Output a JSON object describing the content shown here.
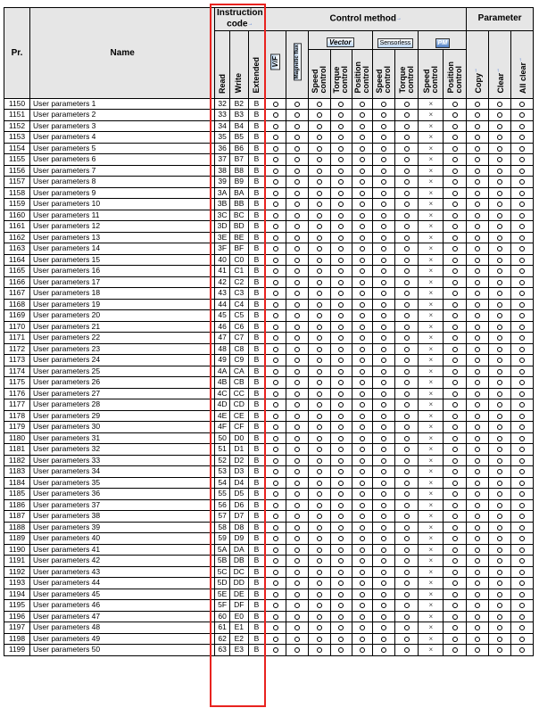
{
  "header": {
    "pr": "Pr.",
    "name": "Name",
    "instruction_code": "Instruction\ncode",
    "control_method": "Control method",
    "parameter": "Parameter",
    "read": "Read",
    "write": "Write",
    "extended": "Extended",
    "vf_badge": "V/F",
    "magnetic_flux_badge": "Magnetic flux",
    "vector_badge": "Vector",
    "sensorless_badge": "Sensorless",
    "pm_badge": "PM",
    "speed_control": "Speed\ncontrol",
    "torque_control": "Torque\ncontrol",
    "position_control": "Position\ncontrol",
    "copy": "Copy",
    "clear": "Clear",
    "all_clear": "All clear"
  },
  "mark_symbol": "→",
  "accent_color": "#e8231f",
  "header_bg_color": "#e6e6e6",
  "column_marks": [
    "o",
    "o",
    "o",
    "o",
    "o",
    "o",
    "o",
    "x",
    "o",
    "o",
    "o",
    "o"
  ],
  "rows": [
    {
      "pr": "1150",
      "name": "User parameters 1",
      "read": "32",
      "write": "B2",
      "ext": "B"
    },
    {
      "pr": "1151",
      "name": "User parameters 2",
      "read": "33",
      "write": "B3",
      "ext": "B"
    },
    {
      "pr": "1152",
      "name": "User parameters 3",
      "read": "34",
      "write": "B4",
      "ext": "B"
    },
    {
      "pr": "1153",
      "name": "User parameters 4",
      "read": "35",
      "write": "B5",
      "ext": "B"
    },
    {
      "pr": "1154",
      "name": "User parameters 5",
      "read": "36",
      "write": "B6",
      "ext": "B"
    },
    {
      "pr": "1155",
      "name": "User parameters 6",
      "read": "37",
      "write": "B7",
      "ext": "B"
    },
    {
      "pr": "1156",
      "name": "User parameters 7",
      "read": "38",
      "write": "B8",
      "ext": "B"
    },
    {
      "pr": "1157",
      "name": "User parameters 8",
      "read": "39",
      "write": "B9",
      "ext": "B"
    },
    {
      "pr": "1158",
      "name": "User parameters 9",
      "read": "3A",
      "write": "BA",
      "ext": "B"
    },
    {
      "pr": "1159",
      "name": "User parameters 10",
      "read": "3B",
      "write": "BB",
      "ext": "B"
    },
    {
      "pr": "1160",
      "name": "User parameters 11",
      "read": "3C",
      "write": "BC",
      "ext": "B"
    },
    {
      "pr": "1161",
      "name": "User parameters 12",
      "read": "3D",
      "write": "BD",
      "ext": "B"
    },
    {
      "pr": "1162",
      "name": "User parameters 13",
      "read": "3E",
      "write": "BE",
      "ext": "B"
    },
    {
      "pr": "1163",
      "name": "User parameters 14",
      "read": "3F",
      "write": "BF",
      "ext": "B"
    },
    {
      "pr": "1164",
      "name": "User parameters 15",
      "read": "40",
      "write": "C0",
      "ext": "B"
    },
    {
      "pr": "1165",
      "name": "User parameters 16",
      "read": "41",
      "write": "C1",
      "ext": "B"
    },
    {
      "pr": "1166",
      "name": "User parameters 17",
      "read": "42",
      "write": "C2",
      "ext": "B"
    },
    {
      "pr": "1167",
      "name": "User parameters 18",
      "read": "43",
      "write": "C3",
      "ext": "B"
    },
    {
      "pr": "1168",
      "name": "User parameters 19",
      "read": "44",
      "write": "C4",
      "ext": "B"
    },
    {
      "pr": "1169",
      "name": "User parameters 20",
      "read": "45",
      "write": "C5",
      "ext": "B"
    },
    {
      "pr": "1170",
      "name": "User parameters 21",
      "read": "46",
      "write": "C6",
      "ext": "B"
    },
    {
      "pr": "1171",
      "name": "User parameters 22",
      "read": "47",
      "write": "C7",
      "ext": "B"
    },
    {
      "pr": "1172",
      "name": "User parameters 23",
      "read": "48",
      "write": "C8",
      "ext": "B"
    },
    {
      "pr": "1173",
      "name": "User parameters 24",
      "read": "49",
      "write": "C9",
      "ext": "B"
    },
    {
      "pr": "1174",
      "name": "User parameters 25",
      "read": "4A",
      "write": "CA",
      "ext": "B"
    },
    {
      "pr": "1175",
      "name": "User parameters 26",
      "read": "4B",
      "write": "CB",
      "ext": "B"
    },
    {
      "pr": "1176",
      "name": "User parameters 27",
      "read": "4C",
      "write": "CC",
      "ext": "B"
    },
    {
      "pr": "1177",
      "name": "User parameters 28",
      "read": "4D",
      "write": "CD",
      "ext": "B"
    },
    {
      "pr": "1178",
      "name": "User parameters 29",
      "read": "4E",
      "write": "CE",
      "ext": "B"
    },
    {
      "pr": "1179",
      "name": "User parameters 30",
      "read": "4F",
      "write": "CF",
      "ext": "B"
    },
    {
      "pr": "1180",
      "name": "User parameters 31",
      "read": "50",
      "write": "D0",
      "ext": "B"
    },
    {
      "pr": "1181",
      "name": "User parameters 32",
      "read": "51",
      "write": "D1",
      "ext": "B"
    },
    {
      "pr": "1182",
      "name": "User parameters 33",
      "read": "52",
      "write": "D2",
      "ext": "B"
    },
    {
      "pr": "1183",
      "name": "User parameters 34",
      "read": "53",
      "write": "D3",
      "ext": "B"
    },
    {
      "pr": "1184",
      "name": "User parameters 35",
      "read": "54",
      "write": "D4",
      "ext": "B"
    },
    {
      "pr": "1185",
      "name": "User parameters 36",
      "read": "55",
      "write": "D5",
      "ext": "B"
    },
    {
      "pr": "1186",
      "name": "User parameters 37",
      "read": "56",
      "write": "D6",
      "ext": "B"
    },
    {
      "pr": "1187",
      "name": "User parameters 38",
      "read": "57",
      "write": "D7",
      "ext": "B"
    },
    {
      "pr": "1188",
      "name": "User parameters 39",
      "read": "58",
      "write": "D8",
      "ext": "B"
    },
    {
      "pr": "1189",
      "name": "User parameters 40",
      "read": "59",
      "write": "D9",
      "ext": "B"
    },
    {
      "pr": "1190",
      "name": "User parameters 41",
      "read": "5A",
      "write": "DA",
      "ext": "B"
    },
    {
      "pr": "1191",
      "name": "User parameters 42",
      "read": "5B",
      "write": "DB",
      "ext": "B"
    },
    {
      "pr": "1192",
      "name": "User parameters 43",
      "read": "5C",
      "write": "DC",
      "ext": "B"
    },
    {
      "pr": "1193",
      "name": "User parameters 44",
      "read": "5D",
      "write": "DD",
      "ext": "B"
    },
    {
      "pr": "1194",
      "name": "User parameters 45",
      "read": "5E",
      "write": "DE",
      "ext": "B"
    },
    {
      "pr": "1195",
      "name": "User parameters 46",
      "read": "5F",
      "write": "DF",
      "ext": "B"
    },
    {
      "pr": "1196",
      "name": "User parameters 47",
      "read": "60",
      "write": "E0",
      "ext": "B"
    },
    {
      "pr": "1197",
      "name": "User parameters 48",
      "read": "61",
      "write": "E1",
      "ext": "B"
    },
    {
      "pr": "1198",
      "name": "User parameters 49",
      "read": "62",
      "write": "E2",
      "ext": "B"
    },
    {
      "pr": "1199",
      "name": "User parameters 50",
      "read": "63",
      "write": "E3",
      "ext": "B"
    }
  ]
}
